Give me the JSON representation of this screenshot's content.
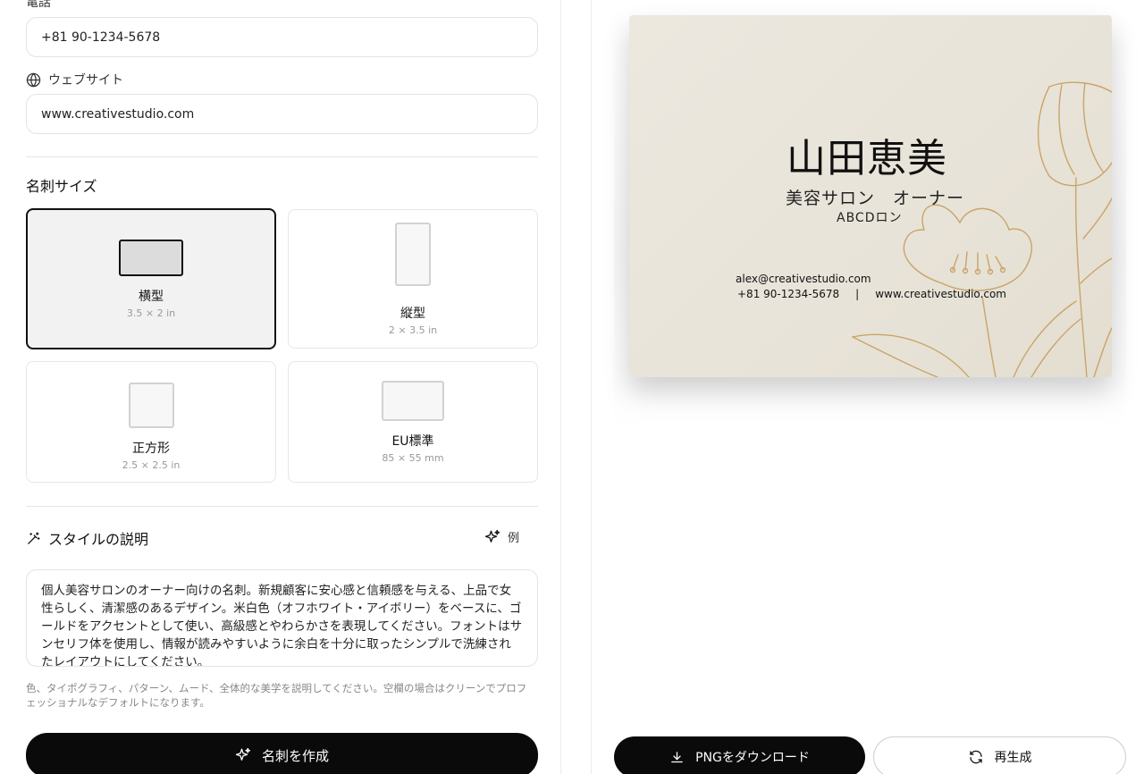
{
  "form": {
    "phone_label": "電話",
    "phone_value": "+81 90-1234-5678",
    "website_label": "ウェブサイト",
    "website_value": "www.creativestudio.com",
    "size_section_title": "名刺サイズ",
    "sizes": [
      {
        "name": "横型",
        "dim": "3.5 × 2 in",
        "selected": true
      },
      {
        "name": "縦型",
        "dim": "2 × 3.5 in",
        "selected": false
      },
      {
        "name": "正方形",
        "dim": "2.5 × 2.5 in",
        "selected": false
      },
      {
        "name": "EU標準",
        "dim": "85 × 55 mm",
        "selected": false
      }
    ],
    "style_title": "スタイルの説明",
    "example_label": "例",
    "style_text": "個人美容サロンのオーナー向けの名刺。新規顧客に安心感と信頼感を与える、上品で女性らしく、清潔感のあるデザイン。米白色（オフホワイト・アイボリー）をベースに、ゴールドをアクセントとして使い、高級感とやわらかさを表現してください。フォントはサンセリフ体を使用し、情報が読みやすいように余白を十分に取ったシンプルで洗練されたレイアウトにしてください。",
    "hint": "色、タイポグラフィ、パターン、ムード、全体的な美学を説明してください。空欄の場合はクリーンでプロフェッショナルなデフォルトになります。",
    "create_button": "名刺を作成"
  },
  "preview": {
    "name": "山田恵美",
    "title": "美容サロン　オーナー",
    "company": "ABCDロン",
    "email": "alex@creativestudio.com",
    "phone": "+81 90-1234-5678",
    "separator": "|",
    "website": "www.creativestudio.com",
    "download_button": "PNGをダウンロード",
    "regenerate_button": "再生成"
  },
  "colors": {
    "accent_dark": "#0a0a0a",
    "card_bg": "#ece8df",
    "gold": "#c9a46a"
  }
}
